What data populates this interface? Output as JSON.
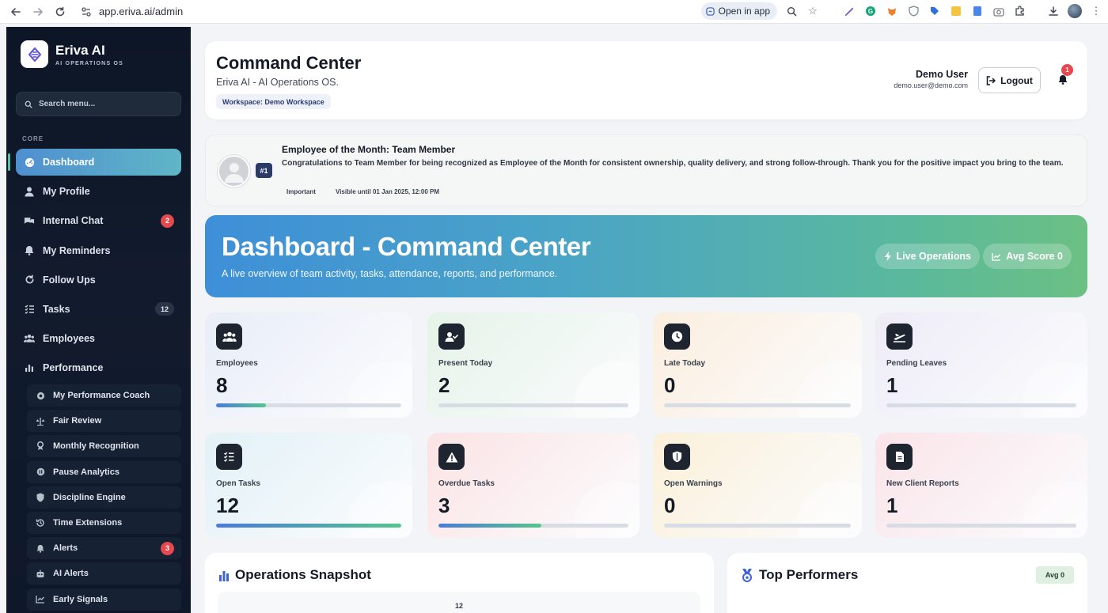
{
  "browser": {
    "url": "app.eriva.ai/admin",
    "open_in_app": "Open in app"
  },
  "sidebar": {
    "brand_name": "Eriva AI",
    "brand_sub": "AI OPERATIONS OS",
    "search_placeholder": "Search menu...",
    "section_label": "CORE",
    "items": [
      {
        "label": "Dashboard",
        "icon": "dashboard-icon",
        "active": true
      },
      {
        "label": "My Profile",
        "icon": "user-icon"
      },
      {
        "label": "Internal Chat",
        "icon": "chat-icon",
        "badge": "2"
      },
      {
        "label": "My Reminders",
        "icon": "bell-icon"
      },
      {
        "label": "Follow Ups",
        "icon": "refresh-icon"
      },
      {
        "label": "Tasks",
        "icon": "tasks-icon",
        "badge": "12"
      },
      {
        "label": "Employees",
        "icon": "users-icon"
      },
      {
        "label": "Performance",
        "icon": "bar-chart-icon"
      }
    ],
    "sub_items": [
      {
        "label": "My Performance Coach",
        "icon": "target-icon"
      },
      {
        "label": "Fair Review",
        "icon": "balance-icon"
      },
      {
        "label": "Monthly Recognition",
        "icon": "award-icon"
      },
      {
        "label": "Pause Analytics",
        "icon": "pause-icon"
      },
      {
        "label": "Discipline Engine",
        "icon": "shield-icon"
      },
      {
        "label": "Time Extensions",
        "icon": "history-icon"
      },
      {
        "label": "Alerts",
        "icon": "bell-icon",
        "badge": "3"
      },
      {
        "label": "AI Alerts",
        "icon": "robot-icon"
      },
      {
        "label": "Early Signals",
        "icon": "trend-icon"
      }
    ]
  },
  "header": {
    "title": "Command Center",
    "subtitle": "Eriva AI - AI Operations OS.",
    "workspace": "Workspace: Demo Workspace",
    "user_name": "Demo User",
    "user_email": "demo.user@demo.com",
    "logout_label": "Logout",
    "notifications_count": "1"
  },
  "announcement": {
    "title": "Employee of the Month: Team Member",
    "body": "Congratulations to Team Member for being recognized as Employee of the Month for consistent ownership, quality delivery, and strong follow-through. Thank you for the positive impact you bring to the team.",
    "rank": "#1",
    "tag": "Important",
    "visible_until": "Visible until 01 Jan 2025, 12:00 PM"
  },
  "hero": {
    "title": "Dashboard - Command Center",
    "subtitle": "A live overview of team activity, tasks, attendance, reports, and performance.",
    "live_label": "Live Operations",
    "avg_label": "Avg Score 0"
  },
  "stats": [
    {
      "label": "Employees",
      "value": "8",
      "icon": "users-icon",
      "progress": 0.27,
      "bg": "#e8edf7"
    },
    {
      "label": "Present Today",
      "value": "2",
      "icon": "user-check-icon",
      "progress": 0,
      "bg": "#e5f3e8"
    },
    {
      "label": "Late Today",
      "value": "0",
      "icon": "clock-icon",
      "progress": 0,
      "bg": "#fbeede"
    },
    {
      "label": "Pending Leaves",
      "value": "1",
      "icon": "plane-icon",
      "progress": 0,
      "bg": "#eeebf6"
    },
    {
      "label": "Open Tasks",
      "value": "12",
      "icon": "tasks-icon",
      "progress": 1.0,
      "bg": "#e2f1f6"
    },
    {
      "label": "Overdue Tasks",
      "value": "3",
      "icon": "warning-icon",
      "progress": 0.54,
      "bg": "#fbe3e4"
    },
    {
      "label": "Open Warnings",
      "value": "0",
      "icon": "shield-icon",
      "progress": 0,
      "bg": "#fbf0d9"
    },
    {
      "label": "New Client Reports",
      "value": "1",
      "icon": "document-icon",
      "progress": 0,
      "bg": "#fae4e9"
    }
  ],
  "operations": {
    "title": "Operations Snapshot",
    "top_tick": "12"
  },
  "top_performers": {
    "title": "Top Performers",
    "avg_label": "Avg 0"
  }
}
